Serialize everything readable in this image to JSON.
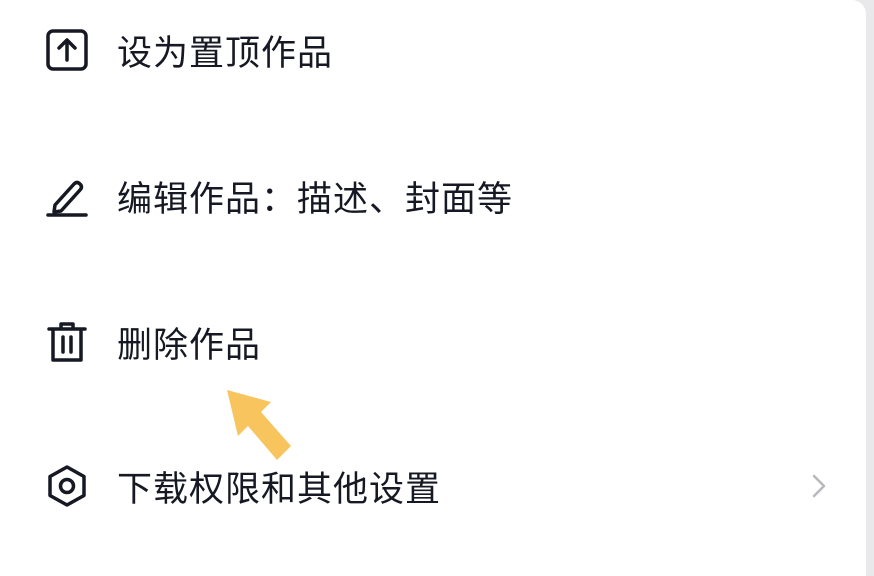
{
  "menu": {
    "items": [
      {
        "label": "设为置顶作品",
        "icon": "pin-top-icon"
      },
      {
        "label": "编辑作品：描述、封面等",
        "icon": "edit-pen-icon"
      },
      {
        "label": "删除作品",
        "icon": "trash-icon"
      },
      {
        "label": "下载权限和其他设置",
        "icon": "settings-hexagon-icon",
        "has_chevron": true
      }
    ]
  },
  "colors": {
    "text": "#161823",
    "icon": "#161823",
    "chevron": "#b8b8bd",
    "highlight_arrow": "#f7c45e",
    "background": "#ffffff"
  }
}
